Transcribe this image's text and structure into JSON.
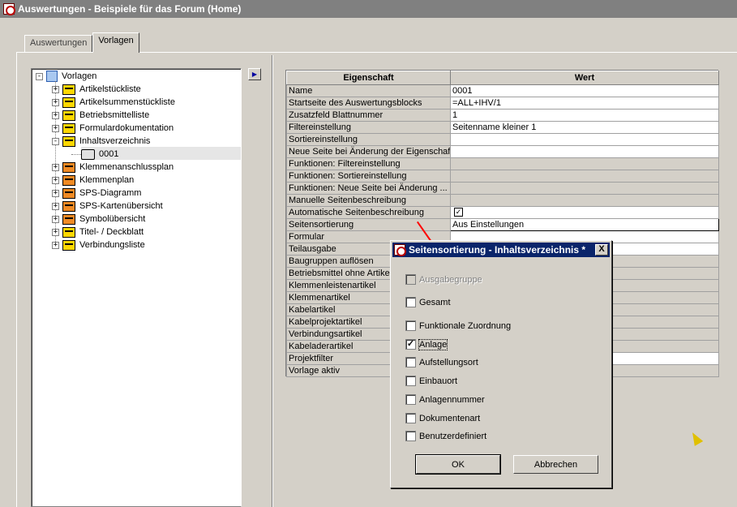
{
  "window": {
    "title": "Auswertungen - Beispiele für das Forum (Home)"
  },
  "tabs": [
    {
      "label": "Auswertungen",
      "active": false
    },
    {
      "label": "Vorlagen",
      "active": true
    }
  ],
  "tree": {
    "root": "Vorlagen",
    "items": [
      {
        "label": "Artikelstückliste",
        "icon": "folder-icon",
        "color": "#ffd700",
        "expander": "+"
      },
      {
        "label": "Artikelsummenstückliste",
        "icon": "folder-icon",
        "color": "#ffd700",
        "expander": "+"
      },
      {
        "label": "Betriebsmittelliste",
        "icon": "folder-icon",
        "color": "#ffd700",
        "expander": "+"
      },
      {
        "label": "Formulardokumentation",
        "icon": "folder-icon",
        "color": "#ffd700",
        "expander": "+"
      },
      {
        "label": "Inhaltsverzeichnis",
        "icon": "folder-icon",
        "color": "#ffd700",
        "expander": "-"
      },
      {
        "label": "0001",
        "icon": "printer-icon",
        "child": true
      },
      {
        "label": "Klemmenanschlussplan",
        "icon": "folder-icon",
        "color": "#f08a24",
        "expander": "+"
      },
      {
        "label": "Klemmenplan",
        "icon": "folder-icon",
        "color": "#f08a24",
        "expander": "+"
      },
      {
        "label": "SPS-Diagramm",
        "icon": "folder-icon",
        "color": "#f08a24",
        "expander": "+"
      },
      {
        "label": "SPS-Kartenübersicht",
        "icon": "folder-icon",
        "color": "#f08a24",
        "expander": "+"
      },
      {
        "label": "Symbolübersicht",
        "icon": "folder-icon",
        "color": "#f08a24",
        "expander": "+"
      },
      {
        "label": "Titel- / Deckblatt",
        "icon": "folder-icon",
        "color": "#ffd700",
        "expander": "+"
      },
      {
        "label": "Verbindungsliste",
        "icon": "folder-icon",
        "color": "#ffd700",
        "expander": "+"
      }
    ]
  },
  "grid": {
    "headers": {
      "property": "Eigenschaft",
      "value": "Wert"
    },
    "rows": [
      {
        "property": "Name",
        "value": "0001"
      },
      {
        "property": "Startseite des Auswertungsblocks",
        "value": "=ALL+IHV/1"
      },
      {
        "property": "Zusatzfeld Blattnummer",
        "value": "1"
      },
      {
        "property": "Filtereinstellung",
        "value": "Seitenname kleiner 1"
      },
      {
        "property": "Sortiereinstellung",
        "value": ""
      },
      {
        "property": "Neue Seite bei Änderung der Eigenschaft",
        "value": ""
      },
      {
        "property": "Funktionen: Filtereinstellung",
        "value": "",
        "gray": true
      },
      {
        "property": "Funktionen: Sortiereinstellung",
        "value": "",
        "gray": true
      },
      {
        "property": "Funktionen: Neue Seite bei Änderung ...",
        "value": "",
        "gray": true
      },
      {
        "property": "Manuelle Seitenbeschreibung",
        "value": "",
        "gray": true
      },
      {
        "property": "Automatische Seitenbeschreibung",
        "value": "",
        "checkbox": true,
        "checked": true
      },
      {
        "property": "Seitensortierung",
        "value": "Aus Einstellungen",
        "focus": true
      },
      {
        "property": "Formular",
        "value": ""
      },
      {
        "property": "Teilausgabe",
        "value": ""
      },
      {
        "property": "Baugruppen auflösen",
        "value": "",
        "gray": true
      },
      {
        "property": "Betriebsmittel ohne Artikel",
        "value": "",
        "gray": true
      },
      {
        "property": "Klemmenleistenartikel",
        "value": "",
        "gray": true
      },
      {
        "property": "Klemmenartikel",
        "value": "",
        "gray": true
      },
      {
        "property": "Kabelartikel",
        "value": "",
        "gray": true
      },
      {
        "property": "Kabelprojektartikel",
        "value": "",
        "gray": true
      },
      {
        "property": "Verbindungsartikel",
        "value": "",
        "gray": true
      },
      {
        "property": "Kabeladerartikel",
        "value": "",
        "gray": true
      },
      {
        "property": "Projektfilter",
        "value": ""
      },
      {
        "property": "Vorlage aktiv",
        "value": "",
        "gray": true
      }
    ]
  },
  "dialog": {
    "title": "Seitensortierung - Inhaltsverzeichnis *",
    "close_label": "X",
    "options": [
      {
        "label": "Ausgabegruppe",
        "checked": false,
        "disabled": true
      },
      {
        "label": "Gesamt",
        "checked": false
      },
      {
        "label": "Funktionale Zuordnung",
        "checked": false
      },
      {
        "label": "Anlage",
        "checked": true,
        "focus": true
      },
      {
        "label": "Aufstellungsort",
        "checked": false
      },
      {
        "label": "Einbauort",
        "checked": false
      },
      {
        "label": "Anlagennummer",
        "checked": false
      },
      {
        "label": "Dokumentenart",
        "checked": false
      },
      {
        "label": "Benutzerdefiniert",
        "checked": false
      }
    ],
    "ok_label": "OK",
    "cancel_label": "Abbrechen"
  },
  "colors": {
    "dialog_title_bg": "#0a246a",
    "window_title_bg": "#808080",
    "annotation_red": "#ff0000"
  }
}
